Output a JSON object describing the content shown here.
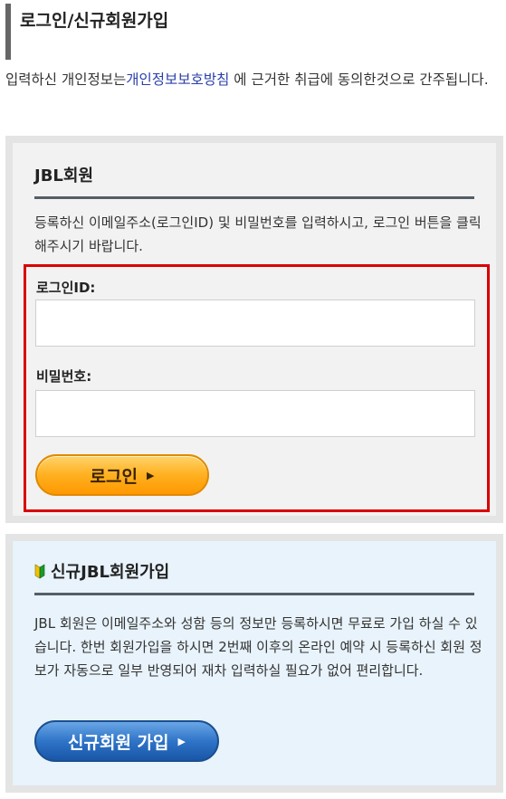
{
  "page": {
    "title": "로그인/신규회원가입",
    "intro_before": "입력하신 개인정보는",
    "intro_link": "개인정보보호방침",
    "intro_after": " 에 근거한 취급에 동의한것으로 간주됩니다.",
    "link_color": "#2a3fa8"
  },
  "login": {
    "heading": "JBL회원",
    "description": "등록하신 이메일주소(로그인ID) 및 비밀번호를 입력하시고, 로그인 버튼을 클릭해주시기 바랍니다.",
    "id_label": "로그인ID:",
    "id_value": "",
    "password_label": "비밀번호:",
    "password_value": "",
    "button_label": "로그인",
    "button_icon": "play-triangle-icon",
    "highlight_color": "#d90000",
    "button_color": "#ffa500"
  },
  "signup": {
    "heading": "신규JBL회원가입",
    "heading_icon": "beginner-leaf-icon",
    "description": "JBL 회원은 이메일주소와 성함 등의 정보만 등록하시면 무료로 가입 하실 수 있습니다. 한번 회원가입을 하시면 2번째 이후의 온라인 예약 시 등록하신 회원 정보가 자동으로 일부 반영되어 재차 입력하실 필요가 없어 편리합니다.",
    "button_label": "신규회원 가입",
    "button_icon": "play-triangle-icon",
    "button_color": "#2f74c8"
  }
}
